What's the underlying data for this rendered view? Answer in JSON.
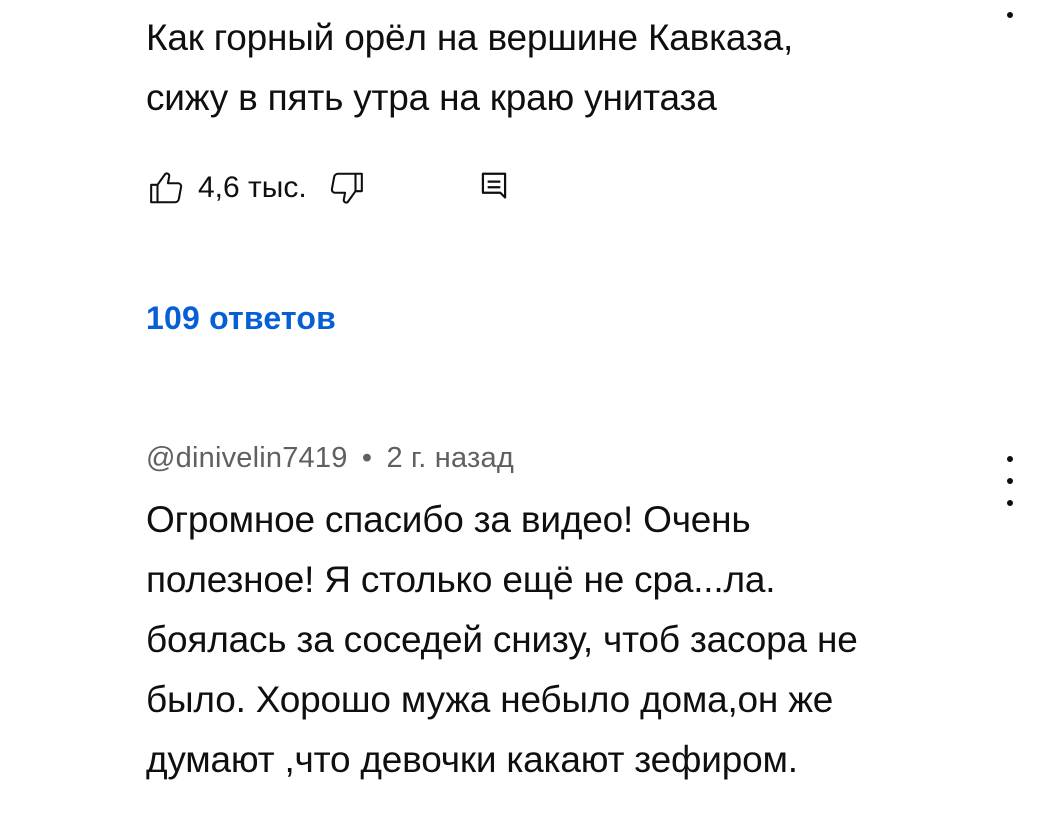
{
  "comments": [
    {
      "text": "Как горный орёл на вершине Кавказа,\nсижу в пять утра на краю унитаза",
      "likes": "4,6 тыс.",
      "replies_label": "109 ответов",
      "icons": [
        "thumbs-up-icon",
        "thumbs-down-icon",
        "reply-comment-icon",
        "more-vertical-icon"
      ]
    },
    {
      "author": "@dinivelin7419",
      "separator": "•",
      "time": "2 г. назад",
      "text": "Огромное спасибо за видео! Очень\nполезное! Я столько ещё не сра...ла.\nбоялась за соседей снизу, чтоб засора не\nбыло. Хорошо мужа небыло дома,он же\nдумают ,что девочки какают зефиром.",
      "icons": [
        "more-vertical-icon"
      ]
    }
  ],
  "colors": {
    "text": "#0f0f0f",
    "meta": "#606060",
    "link": "#065fd4",
    "background": "#ffffff"
  }
}
